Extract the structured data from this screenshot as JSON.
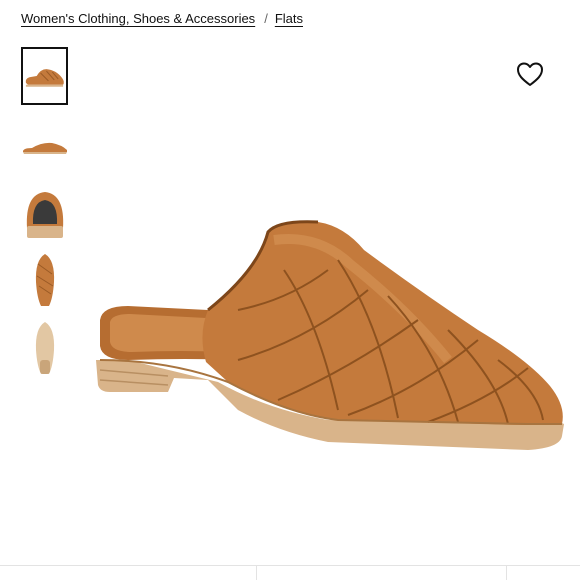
{
  "breadcrumb": {
    "items": [
      "Women's Clothing, Shoes & Accessories",
      "Flats"
    ],
    "separator": "/"
  },
  "thumbnails": [
    {
      "icon": "shoe-side-view-thumbnail",
      "selected": true
    },
    {
      "icon": "shoe-profile-thumbnail",
      "selected": false
    },
    {
      "icon": "shoe-back-view-thumbnail",
      "selected": false
    },
    {
      "icon": "shoe-top-view-thumbnail",
      "selected": false
    },
    {
      "icon": "shoe-sole-thumbnail",
      "selected": false
    }
  ],
  "wishlist": {
    "icon": "heart-icon"
  },
  "colors": {
    "leather": "#c47a3c",
    "leather_dark": "#9a5a25",
    "sole": "#d9b48a",
    "text": "#111111"
  }
}
